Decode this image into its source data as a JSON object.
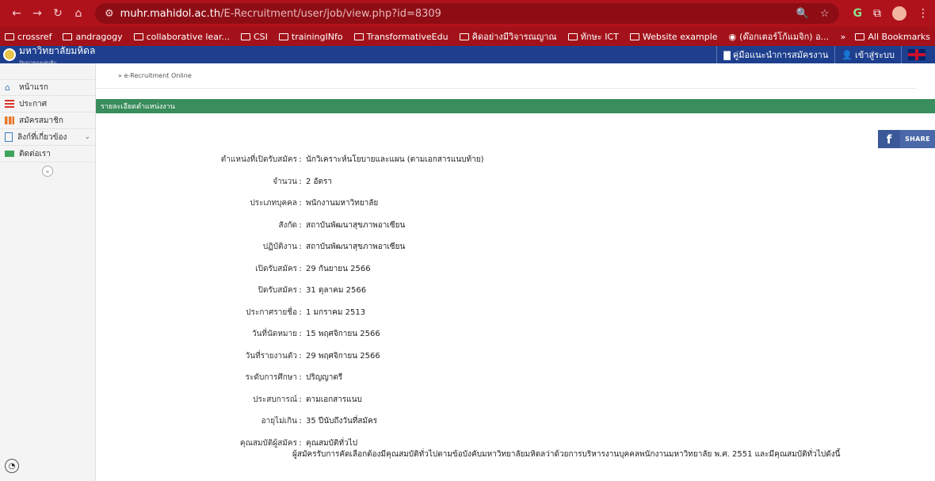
{
  "browser": {
    "url_host": "muhr.mahidol.ac.th",
    "url_path": "/E-Recruitment/user/job/view.php?id=8309",
    "bookmarks": [
      "crossref",
      "andragogy",
      "collaborative lear...",
      "CSI",
      "trainingINfo",
      "TransformativeEdu",
      "คิดอย่างมีวิจารณญาณ",
      "ทักษะ ICT",
      "Website example",
      "(ด๊อกเตอร์โก้แมจิก) อ..."
    ],
    "all_bookmarks": "All Bookmarks",
    "more": "»"
  },
  "header": {
    "site_name": "มหาวิทยาลัยมหิดล",
    "site_sub": "ปัญญาของแผ่นดิน",
    "manual_link": "คู่มือแนะนำการสมัครงาน",
    "login_link": "เข้าสู่ระบบ"
  },
  "sidebar": {
    "items": [
      {
        "label": "หน้าแรก"
      },
      {
        "label": "ประกาศ"
      },
      {
        "label": "สมัครสมาชิก"
      },
      {
        "label": "ลิงก์ที่เกี่ยวข้อง"
      },
      {
        "label": "ติดต่อเรา"
      }
    ]
  },
  "breadcrumb": "» e-Recruitment Online",
  "section_title": "รายละเอียดตำแหน่งงาน",
  "share_label": "SHARE",
  "details": [
    {
      "key": "ตำแหน่งที่เปิดรับสมัคร",
      "value": "นักวิเคราะห์นโยบายและแผน (ตามเอกสารแนบท้าย)"
    },
    {
      "key": "จำนวน",
      "value": "2 อัตรา"
    },
    {
      "key": "ประเภทบุคคล",
      "value": "พนักงานมหาวิทยาลัย"
    },
    {
      "key": "สังกัด",
      "value": "สถาบันพัฒนาสุขภาพอาเซียน"
    },
    {
      "key": "ปฏิบัติงาน",
      "value": "สถาบันพัฒนาสุขภาพอาเซียน"
    },
    {
      "key": "เปิดรับสมัคร",
      "value": "29 กันยายน 2566"
    },
    {
      "key": "ปิดรับสมัคร",
      "value": "31 ตุลาคม 2566"
    },
    {
      "key": "ประกาศรายชื่อ",
      "value": "1 มกราคม 2513"
    },
    {
      "key": "วันที่นัดหมาย",
      "value": "15 พฤศจิกายน 2566"
    },
    {
      "key": "วันที่รายงานตัว",
      "value": "29 พฤศจิกายน 2566"
    },
    {
      "key": "ระดับการศึกษา",
      "value": "ปริญญาตรี"
    },
    {
      "key": "ประสบการณ์",
      "value": "ตามเอกสารแนบ"
    },
    {
      "key": "อายุไม่เกิน",
      "value": "35 ปีนับถึงวันที่สมัคร"
    },
    {
      "key": "คุณสมบัติผู้สมัคร",
      "value": "คุณสมบัติทั่วไป"
    }
  ],
  "note": "ผู้สมัครรับการคัดเลือกต้องมีคุณสมบัติทั่วไปตามข้อบังคับมหาวิทยาลัยมหิดลว่าด้วยการบริหารงานบุคคลพนักงานมหาวิทยาลัย พ.ศ. 2551 และมีคุณสมบัติทั่วไปดังนี้"
}
